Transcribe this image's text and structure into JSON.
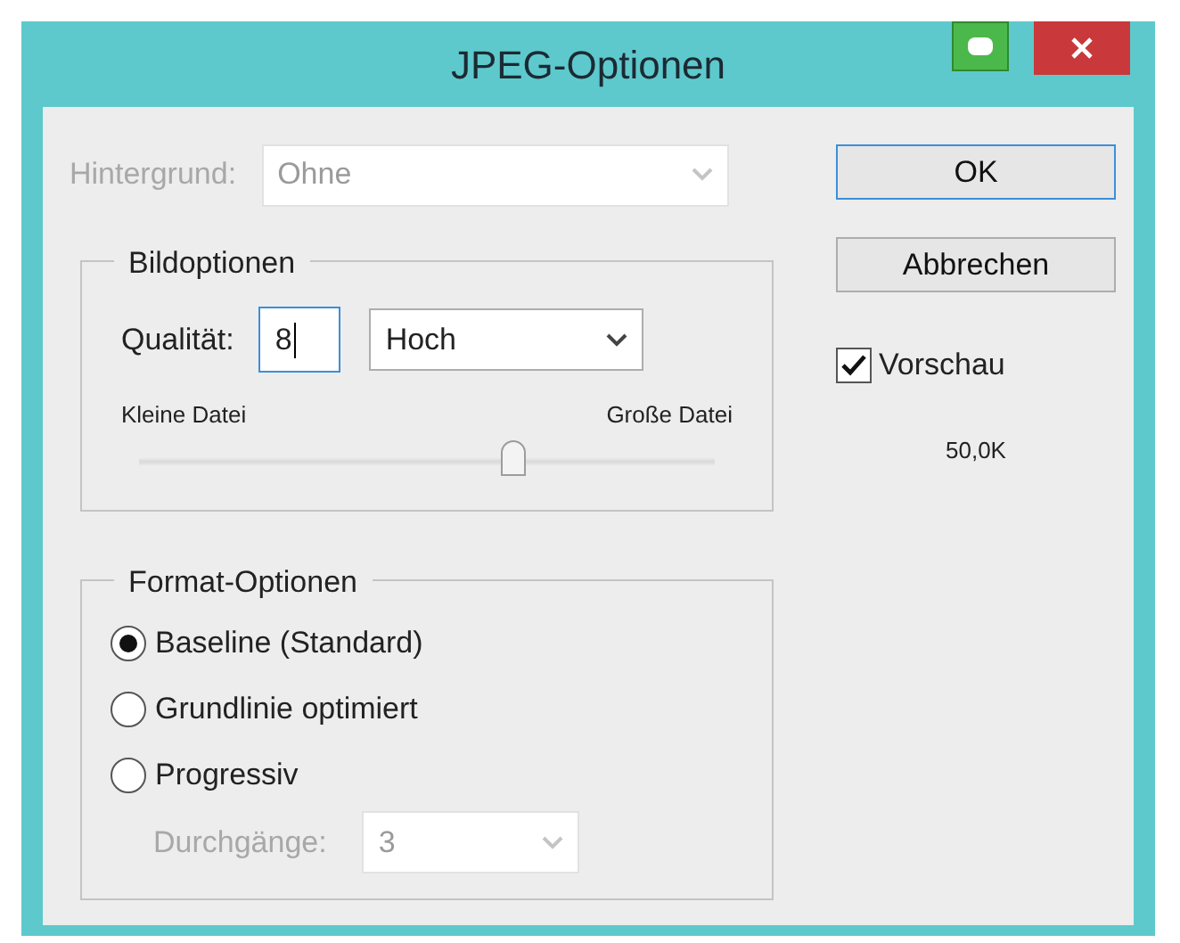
{
  "window": {
    "title": "JPEG-Optionen"
  },
  "background": {
    "label": "Hintergrund:",
    "value": "Ohne",
    "disabled": true
  },
  "image_options": {
    "legend": "Bildoptionen",
    "quality_label": "Qualität:",
    "quality_value": "8",
    "preset": "Hoch",
    "min_label": "Kleine Datei",
    "max_label": "Große Datei",
    "level": 0.65
  },
  "format_options": {
    "legend": "Format-Optionen",
    "choices": [
      {
        "label": "Baseline (Standard)",
        "selected": true
      },
      {
        "label": "Grundlinie optimiert",
        "selected": false
      },
      {
        "label": "Progressiv",
        "selected": false
      }
    ],
    "passes": {
      "label": "Durchgänge:",
      "value": "3",
      "disabled": true
    }
  },
  "buttons": [
    "OK",
    "Abbrechen"
  ],
  "preview": {
    "label": "Vorschau",
    "checked": true
  },
  "file_size": "50,0K"
}
